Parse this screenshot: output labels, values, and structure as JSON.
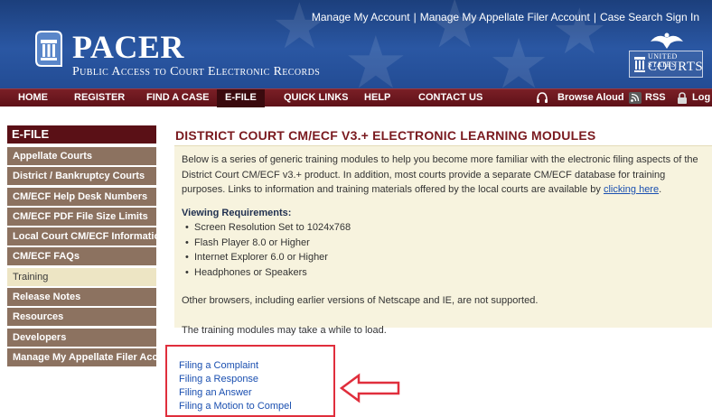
{
  "header": {
    "top_links": [
      "Manage My Account",
      "Manage My Appellate Filer Account",
      "Case Search Sign In"
    ],
    "logo_title": "PACER",
    "logo_subtitle": "Public Access to Court Electronic Records",
    "uscourts_line1": "UNITED STATES",
    "uscourts_line2": "COURTS"
  },
  "nav": {
    "items": [
      "HOME",
      "REGISTER",
      "FIND A CASE",
      "E-FILE",
      "QUICK LINKS",
      "HELP",
      "CONTACT US"
    ],
    "active": "E-FILE",
    "browse_aloud": "Browse Aloud",
    "rss": "RSS",
    "logout": "Log"
  },
  "sidebar": {
    "title": "E-FILE",
    "items": [
      "Appellate Courts",
      "District / Bankruptcy Courts",
      "CM/ECF Help Desk Numbers",
      "CM/ECF PDF File Size Limits",
      "Local Court CM/ECF Information",
      "CM/ECF FAQs",
      "Training",
      "Release Notes",
      "Resources",
      "Developers",
      "Manage My Appellate Filer Account"
    ],
    "active": "Training"
  },
  "main": {
    "heading": "DISTRICT COURT CM/ECF V3.+ ELECTRONIC LEARNING MODULES",
    "intro": "Below is a series of generic training modules to help you become more familiar with the electronic filing aspects of the District Court CM/ECF v3.+ product. In addition, most courts provide a separate CM/ECF database for training purposes. Links to information and training materials offered by the local courts are available by ",
    "intro_link": "clicking here",
    "intro_end": ".",
    "requirements_title": "Viewing Requirements:",
    "requirements": [
      "Screen Resolution Set to 1024x768",
      "Flash Player 8.0 or Higher",
      "Internet Explorer 6.0 or Higher",
      "Headphones or Speakers"
    ],
    "note_browsers": "Other browsers, including earlier versions of Netscape and IE, are not supported.",
    "note_load": "The training modules may take a while to load.",
    "modules": [
      "Filing a Complaint",
      "Filing a Response",
      "Filing an Answer",
      "Filing a Motion to Compel"
    ]
  },
  "colors": {
    "header_blue": "#2a57a3",
    "nav_maroon": "#6b1820",
    "sidebar_item": "#8c7260",
    "heading_red": "#7a1a1f",
    "link_blue": "#1a4fb0",
    "highlight_red": "#e02e3c",
    "info_bg": "#f7f3de"
  }
}
